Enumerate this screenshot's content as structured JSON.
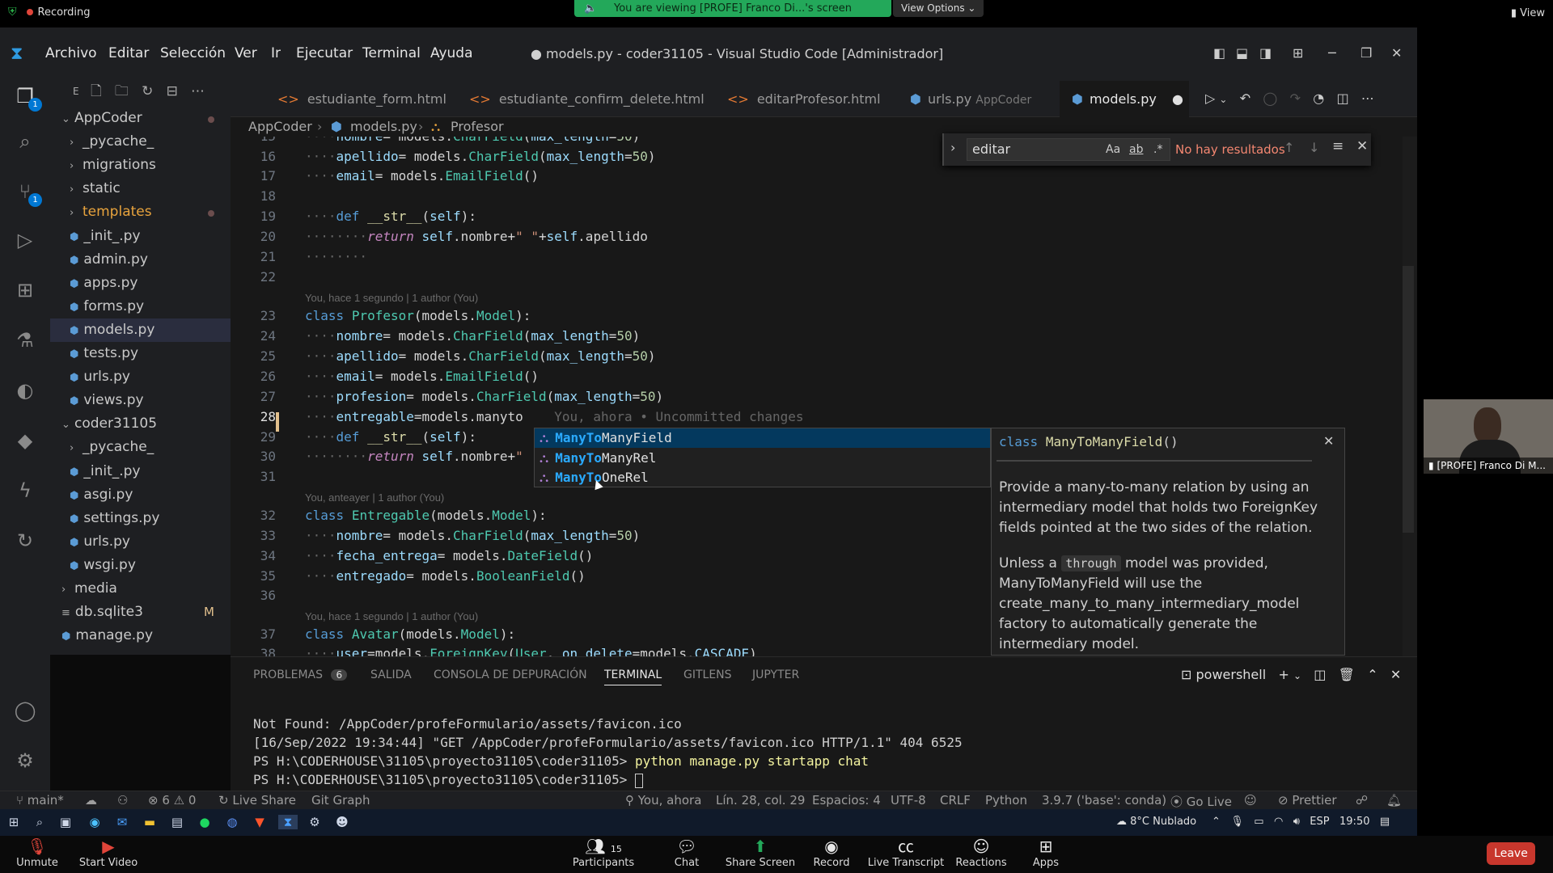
{
  "zoom": {
    "recording": "Recording",
    "viewing": "You are viewing [PROFE] Franco Di...'s screen",
    "view_options": "View Options",
    "view": "View",
    "participant_name": "[PROFE] Franco Di M...",
    "bottom": {
      "unmute": "Unmute",
      "start_video": "Start Video",
      "participants": "Participants",
      "participants_count": "15",
      "chat": "Chat",
      "share_screen": "Share Screen",
      "record": "Record",
      "live_transcript": "Live Transcript",
      "reactions": "Reactions",
      "apps": "Apps",
      "leave": "Leave"
    }
  },
  "vscode": {
    "menu": [
      "Archivo",
      "Editar",
      "Selección",
      "Ver",
      "Ir",
      "Ejecutar",
      "Terminal",
      "Ayuda"
    ],
    "window_title": "● models.py - coder31105 - Visual Studio Code [Administrador]",
    "activity_badges": {
      "explorer": "1",
      "scm": "1"
    },
    "explorer_header": "E",
    "tree": [
      {
        "label": "AppCoder",
        "type": "folder-open",
        "indent": 0,
        "modified_dot": true
      },
      {
        "label": "_pycache_",
        "type": "folder",
        "indent": 1
      },
      {
        "label": "migrations",
        "type": "folder",
        "indent": 1
      },
      {
        "label": "static",
        "type": "folder",
        "indent": 1
      },
      {
        "label": "templates",
        "type": "folder",
        "indent": 1,
        "modified_dot": true,
        "color": "#e8a33d"
      },
      {
        "label": "_init_.py",
        "type": "py",
        "indent": 1
      },
      {
        "label": "admin.py",
        "type": "py",
        "indent": 1
      },
      {
        "label": "apps.py",
        "type": "py",
        "indent": 1
      },
      {
        "label": "forms.py",
        "type": "py",
        "indent": 1
      },
      {
        "label": "models.py",
        "type": "py",
        "indent": 1,
        "selected": true
      },
      {
        "label": "tests.py",
        "type": "py",
        "indent": 1
      },
      {
        "label": "urls.py",
        "type": "py",
        "indent": 1
      },
      {
        "label": "views.py",
        "type": "py",
        "indent": 1
      },
      {
        "label": "coder31105",
        "type": "folder-open",
        "indent": 0
      },
      {
        "label": "_pycache_",
        "type": "folder",
        "indent": 1
      },
      {
        "label": "_init_.py",
        "type": "py",
        "indent": 1
      },
      {
        "label": "asgi.py",
        "type": "py",
        "indent": 1
      },
      {
        "label": "settings.py",
        "type": "py",
        "indent": 1
      },
      {
        "label": "urls.py",
        "type": "py",
        "indent": 1
      },
      {
        "label": "wsgi.py",
        "type": "py",
        "indent": 1
      },
      {
        "label": "media",
        "type": "folder",
        "indent": 0
      },
      {
        "label": "db.sqlite3",
        "type": "db",
        "indent": 0,
        "badge": "M"
      },
      {
        "label": "manage.py",
        "type": "py",
        "indent": 0
      }
    ],
    "tabs": [
      {
        "label": "estudiante_form.html",
        "icon": "<>"
      },
      {
        "label": "estudiante_confirm_delete.html",
        "icon": "<>"
      },
      {
        "label": "editarProfesor.html",
        "icon": "<>"
      },
      {
        "label": "urls.py",
        "sub": "AppCoder",
        "icon": "py"
      },
      {
        "label": "models.py",
        "icon": "py",
        "active": true
      }
    ],
    "breadcrumb": [
      "AppCoder",
      "models.py",
      "Profesor"
    ],
    "find": {
      "value": "editar",
      "aa": "Aa",
      "ab": "ab",
      "regex": ".*",
      "result": "No hay resultados"
    },
    "blames": [
      {
        "after_line": 22,
        "text": "You, hace 1 segundo | 1 author (You)"
      },
      {
        "after_line": 31,
        "text": "You, anteayer | 1 author (You)"
      },
      {
        "after_line": 36,
        "text": "You, hace 1 segundo | 1 author (You)"
      }
    ],
    "inline_blame": "You, ahora • Uncommitted changes",
    "current_line": "28",
    "suggest": {
      "items": [
        "ManyToManyField",
        "ManyToManyRel",
        "ManyToOneRel"
      ],
      "match": "ManyTo"
    },
    "doc": {
      "signature_kw": "class",
      "signature_name": "ManyToManyField",
      "signature_tail": "()",
      "p1": "Provide a many-to-many relation by using an intermediary model that holds two ForeignKey fields pointed at the two sides of the relation.",
      "p2_pre": "Unless a",
      "p2_code": "through",
      "p2_post": "model was provided, ManyToManyField will use the create_many_to_many_intermediary_model factory to automatically generate the intermediary model."
    },
    "panel": {
      "tabs": [
        "PROBLEMAS",
        "SALIDA",
        "CONSOLA DE DEPURACIÓN",
        "TERMINAL",
        "GITLENS",
        "JUPYTER"
      ],
      "problems_count": "6",
      "shell": "powershell",
      "terminal_lines": [
        "Not Found: /AppCoder/profeFormulario/assets/favicon.ico",
        "[16/Sep/2022 19:34:44] \"GET /AppCoder/profeFormulario/assets/favicon.ico HTTP/1.1\" 404 6525",
        "PS H:\\CODERHOUSE\\31105\\proyecto31105\\coder31105> python manage.py startapp chat",
        "PS H:\\CODERHOUSE\\31105\\proyecto31105\\coder31105> "
      ]
    },
    "status": {
      "branch": "main*",
      "errors": "6",
      "warnings": "0",
      "live_share": "Live Share",
      "git_graph": "Git Graph",
      "blame": "You, ahora",
      "position": "Lín. 28, col. 29",
      "spaces": "Espacios: 4",
      "encoding": "UTF-8",
      "eol": "CRLF",
      "language": "Python",
      "interpreter": "3.9.7 ('base': conda)",
      "go_live": "Go Live",
      "prettier": "Prettier"
    }
  },
  "taskbar": {
    "weather": "8°C Nublado",
    "lang": "ESP",
    "time": "19:50"
  },
  "colors": {
    "accent": "#0078d4",
    "zoom_green": "#23a85a",
    "leave_red": "#c8372d"
  }
}
